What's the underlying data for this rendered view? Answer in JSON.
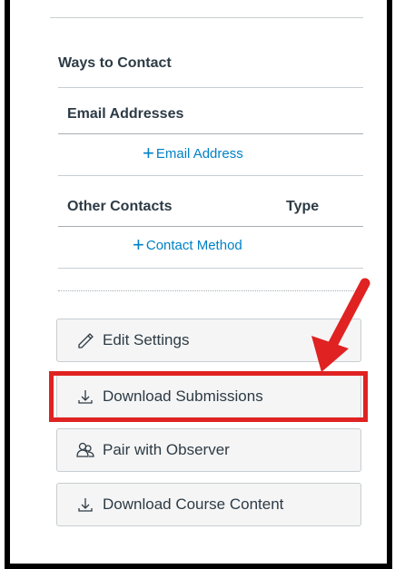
{
  "contact": {
    "title": "Ways to Contact",
    "email_header": "Email Addresses",
    "add_email": "Email Address",
    "other_header": "Other Contacts",
    "type_header": "Type",
    "add_contact": "Contact Method"
  },
  "buttons": {
    "edit_settings": "Edit Settings",
    "download_submissions": "Download Submissions",
    "pair_observer": "Pair with Observer",
    "download_course": "Download Course Content"
  },
  "colors": {
    "link": "#0081c6",
    "highlight": "#e02222",
    "text": "#2d3b45"
  }
}
